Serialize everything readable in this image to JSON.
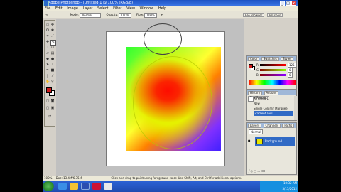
{
  "window": {
    "title": "Adobe Photoshop - [Untitled-1 @ 100% (RGB/8)]"
  },
  "menubar": [
    "File",
    "Edit",
    "Image",
    "Layer",
    "Select",
    "Filter",
    "View",
    "Window",
    "Help"
  ],
  "options": {
    "mode_label": "Mode:",
    "mode_value": "Normal",
    "opacity_label": "Opacity:",
    "opacity_value": "100%",
    "flow_label": "Flow:",
    "flow_value": "100%",
    "panel_buttons": [
      "File Browser",
      "Brushes"
    ]
  },
  "color_panel": {
    "tabs": [
      "Color",
      "Swatches",
      "Styles"
    ],
    "values": {
      "r": "125",
      "g": "0",
      "b": "0"
    },
    "colors": {
      "foreground": "#cc1a1a",
      "background": "#ffffff"
    }
  },
  "history_panel": {
    "tabs": [
      "History",
      "Actions",
      "Tool Presets"
    ],
    "items": [
      "Untitled-1",
      "New",
      "Single Column Marquee",
      "Gradient Tool"
    ]
  },
  "layers_panel": {
    "tabs": [
      "Layers",
      "Channels",
      "Paths"
    ],
    "blend": "Normal",
    "layer_name": "Background"
  },
  "statusbar": {
    "zoom": "100%",
    "doc": "Doc: 13.4M/6.75M",
    "hint": "Click and drag to paint using foreground color. Use Shift, Alt, and Ctrl for additional options."
  },
  "taskbar": {
    "time": "10:32 AM",
    "date": "3/15/2012"
  }
}
